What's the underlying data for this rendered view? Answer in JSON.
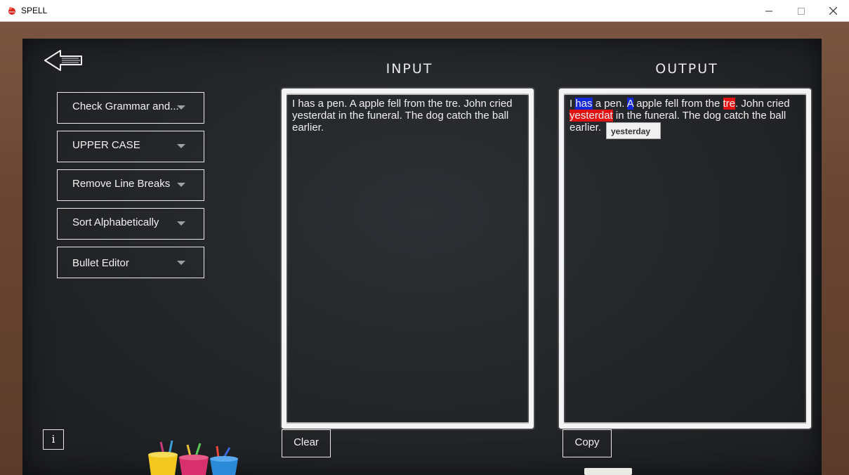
{
  "window": {
    "title": "SPELL",
    "minimize": "—",
    "maximize": "☐",
    "close": "✕"
  },
  "sidebar": {
    "items": [
      {
        "label": "Check Grammar and..."
      },
      {
        "label": "UPPER CASE"
      },
      {
        "label": "Remove Line Breaks"
      },
      {
        "label": "Sort Alphabetically"
      },
      {
        "label": "Bullet Editor"
      }
    ]
  },
  "info_label": "i",
  "input": {
    "title": "INPUT",
    "text": "I has a pen. A apple fell from the tre. John cried yesterdat in the funeral. The dog catch the ball earlier.",
    "clear_label": "Clear"
  },
  "output": {
    "title": "OUTPUT",
    "segments": [
      {
        "text": "I ",
        "hl": ""
      },
      {
        "text": "has",
        "hl": "blue"
      },
      {
        "text": " a pen. ",
        "hl": ""
      },
      {
        "text": "A",
        "hl": "blue"
      },
      {
        "text": " apple fell from the ",
        "hl": ""
      },
      {
        "text": "tre",
        "hl": "red"
      },
      {
        "text": ". John cried ",
        "hl": ""
      },
      {
        "text": "yesterdat",
        "hl": "red"
      },
      {
        "text": " in the funeral. The dog catch the ball earlier.",
        "hl": ""
      }
    ],
    "suggestion": "yesterday",
    "copy_label": "Copy"
  },
  "colors": {
    "grammar_highlight": "#1428d8",
    "spelling_highlight": "#e31212",
    "board": "#222427",
    "frame": "#6b4a36"
  }
}
